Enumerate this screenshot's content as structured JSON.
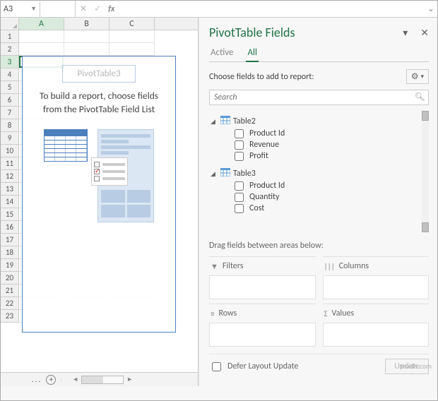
{
  "name_box": "A3",
  "columns": [
    "A",
    "B",
    "C"
  ],
  "rows": [
    "1",
    "2",
    "3",
    "4",
    "5",
    "6",
    "7",
    "8",
    "9",
    "10",
    "11",
    "12",
    "13",
    "14",
    "15",
    "16",
    "17",
    "18",
    "19",
    "20",
    "21",
    "22",
    "23"
  ],
  "active_col": "A",
  "active_row": "3",
  "pivot": {
    "title": "PivotTable3",
    "msg": "To build a report, choose fields from the PivotTable Field List"
  },
  "panel": {
    "title": "PivotTable Fields",
    "tabs": {
      "active": "Active",
      "all": "All"
    },
    "choose": "Choose fields to add to report:",
    "search_placeholder": "Search",
    "tables": [
      {
        "name": "Table2",
        "fields": [
          "Product Id",
          "Revenue",
          "Profit"
        ]
      },
      {
        "name": "Table3",
        "fields": [
          "Product Id",
          "Quantity",
          "Cost"
        ]
      }
    ],
    "drag_label": "Drag fields between areas below:",
    "areas": {
      "filters": "Filters",
      "columns": "Columns",
      "rows": "Rows",
      "values": "Values"
    },
    "defer": "Defer Layout Update",
    "update": "Update"
  },
  "watermark": "wsxdn.com"
}
